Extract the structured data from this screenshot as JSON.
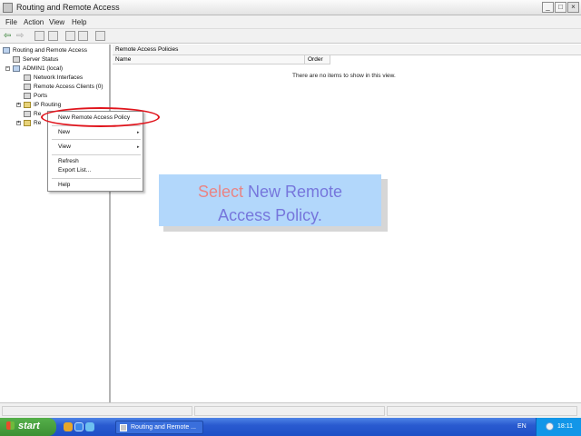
{
  "window": {
    "title": "Routing and Remote Access",
    "controls": {
      "minimize": "_",
      "maximize": "□",
      "close": "×"
    }
  },
  "menu": [
    "File",
    "Action",
    "View",
    "Help"
  ],
  "toolbar": {
    "icons": [
      "back-icon",
      "forward-icon",
      "up-folder-icon",
      "show-hide-tree-icon",
      "properties-icon",
      "refresh-icon",
      "export-icon",
      "help-icon"
    ]
  },
  "tree": {
    "root": "Routing and Remote Access",
    "server_status": "Server Status",
    "server": "ADMIN1 (local)",
    "children": [
      "Network Interfaces",
      "Remote Access Clients (0)",
      "Ports",
      "IP Routing",
      "Re",
      "Re"
    ]
  },
  "right_pane": {
    "title": "Remote Access Policies",
    "columns": [
      "Name",
      "Order"
    ],
    "empty_message": "There are no items to show in this view."
  },
  "context_menu": {
    "items": [
      {
        "label": "New Remote Access Policy",
        "submenu": false
      },
      {
        "label": "New",
        "submenu": true
      },
      {
        "label": "View",
        "submenu": true
      },
      {
        "label": "Refresh",
        "submenu": false
      },
      {
        "label": "Export List...",
        "submenu": false
      },
      {
        "label": "Help",
        "submenu": false
      }
    ],
    "submenu_arrow": "▸"
  },
  "callout": {
    "word1": "Select",
    "word2": "New Remote",
    "line2": "Access Policy."
  },
  "taskbar": {
    "start": "start",
    "task_label": "Routing and Remote ...",
    "language": "EN",
    "clock": "18:11"
  },
  "colors": {
    "highlight_oval": "#e0141c",
    "callout_bg": "#b2d7fb",
    "callout_word1": "#e98484",
    "callout_word2": "#7676dc",
    "taskbar": "#2a5bd0",
    "start_button": "#3c8f33"
  }
}
